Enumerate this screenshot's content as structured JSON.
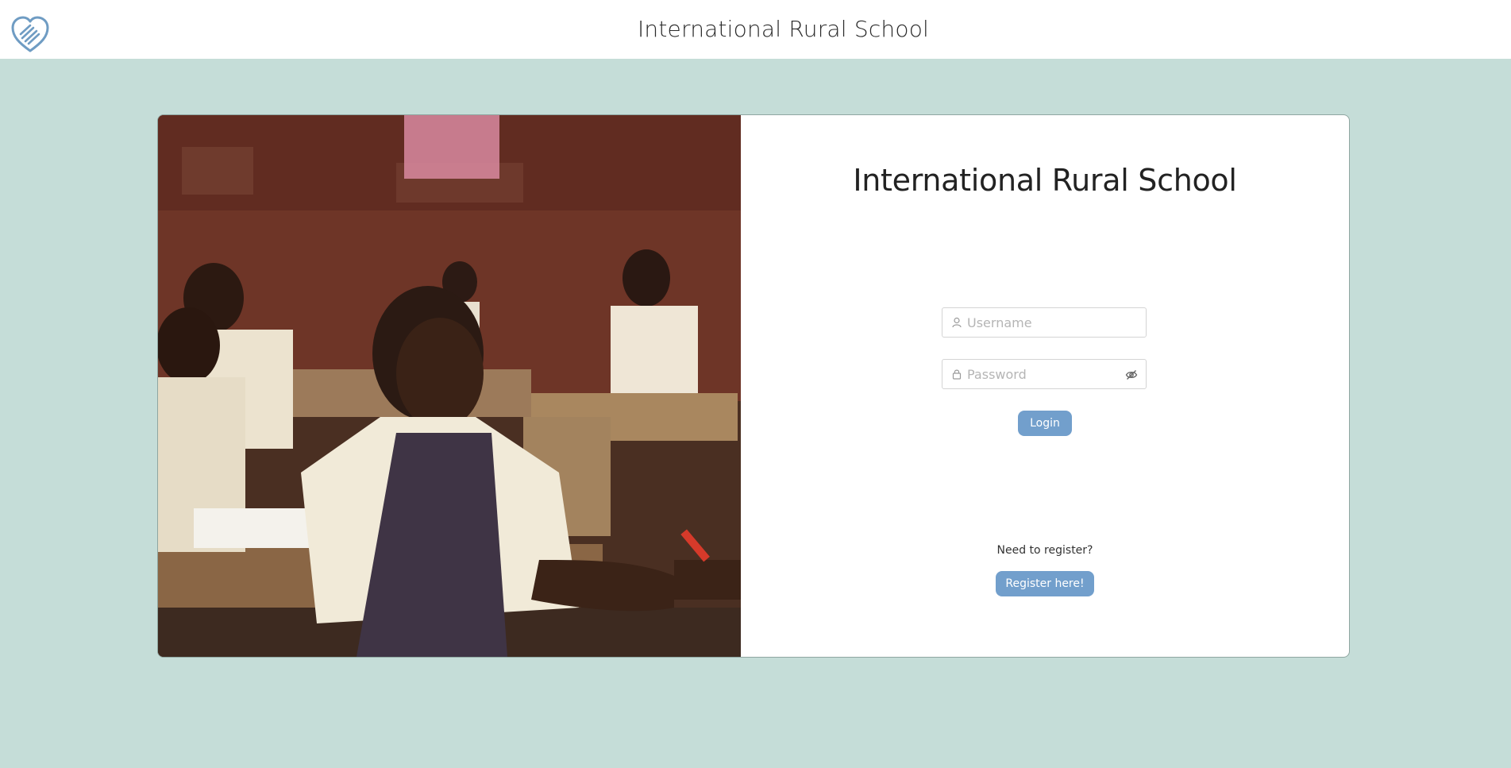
{
  "header": {
    "title": "International Rural School",
    "logo_icon": "heart-hands-icon"
  },
  "photo": {
    "description_icon": "classroom-photo"
  },
  "login": {
    "title": "International Rural School",
    "username_placeholder": "Username",
    "password_placeholder": "Password",
    "username_icon": "user-icon",
    "password_icon": "lock-icon",
    "toggle_icon": "eye-slash-icon",
    "login_label": "Login",
    "register_prompt": "Need to register?",
    "register_label": "Register here!"
  },
  "colors": {
    "background": "#c5ddd8",
    "accent": "#729fcc",
    "logo": "#6f9cc3"
  }
}
